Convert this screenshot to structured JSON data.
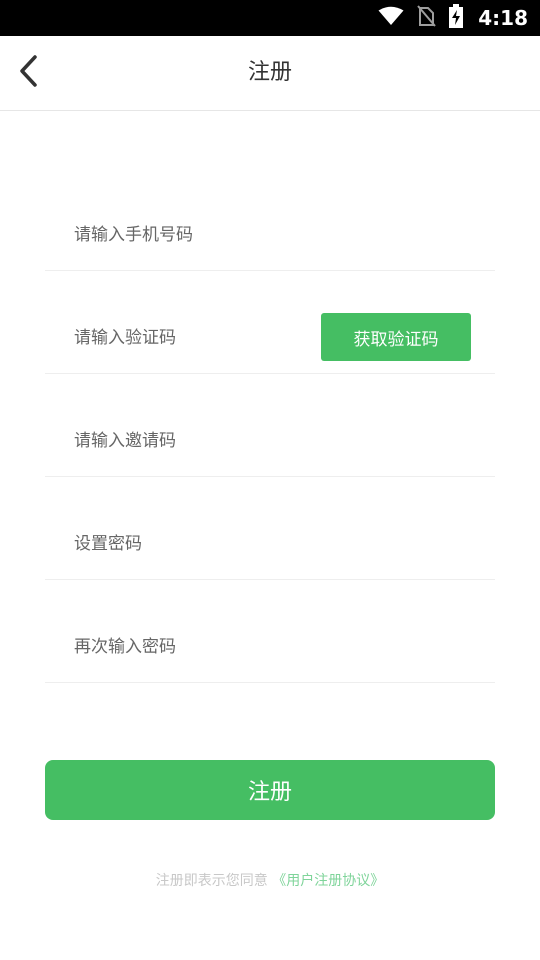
{
  "status_bar": {
    "time": "4:18",
    "icons": [
      "wifi-icon",
      "no-sim-icon",
      "battery-charging-icon"
    ]
  },
  "header": {
    "title": "注册",
    "back_icon": "chevron-left-icon"
  },
  "form": {
    "phone_placeholder": "请输入手机号码",
    "code_placeholder": "请输入验证码",
    "get_code_label": "获取验证码",
    "invite_placeholder": "请输入邀请码",
    "password_placeholder": "设置密码",
    "confirm_password_placeholder": "再次输入密码"
  },
  "submit_label": "注册",
  "agreement": {
    "prefix": "注册即表示您同意",
    "link": "《用户注册协议》"
  },
  "colors": {
    "accent": "#45be63",
    "status_bar": "#000000",
    "link": "#7fd49a"
  }
}
